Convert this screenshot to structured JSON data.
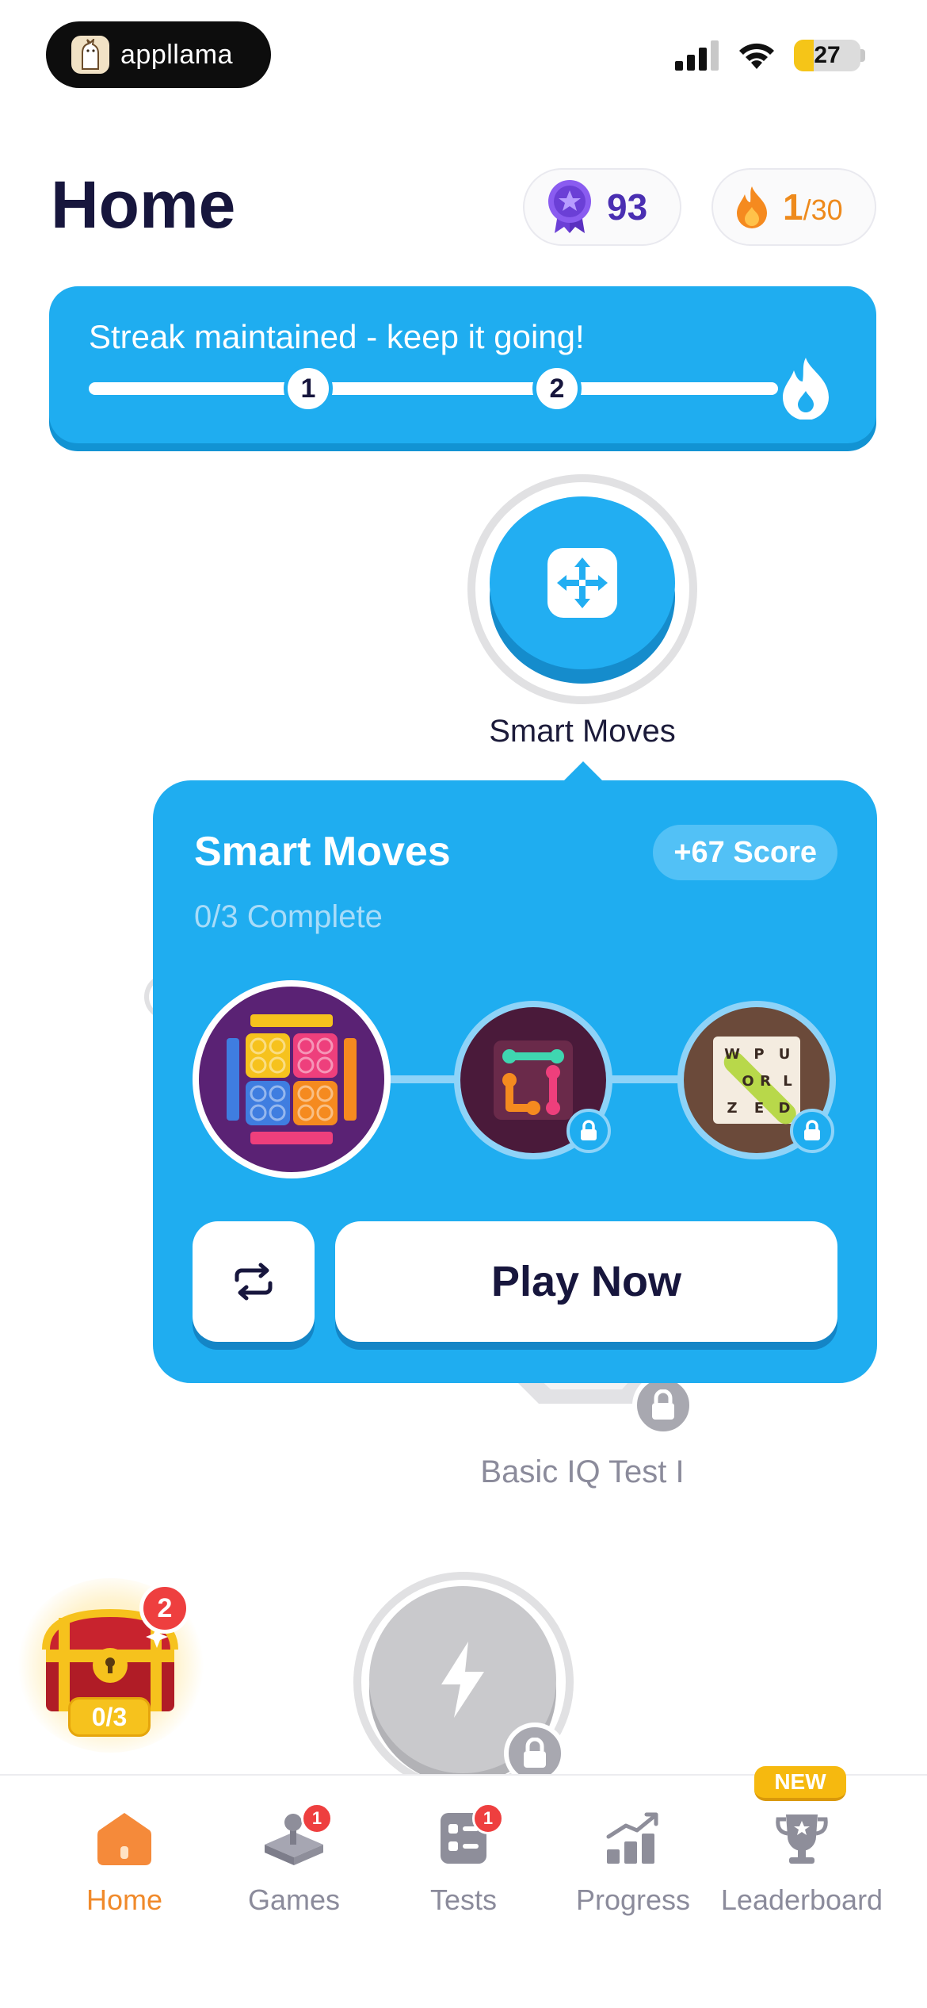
{
  "status_bar": {
    "app_name": "appllama",
    "battery": "27"
  },
  "header": {
    "title": "Home",
    "score": "93",
    "streak_current": "1",
    "streak_total": "/30"
  },
  "streak_banner": {
    "text": "Streak maintained - keep it going!",
    "steps": [
      "1",
      "2"
    ]
  },
  "map": {
    "current_node_label": "Smart Moves",
    "locked_node_label": "Basic IQ Test I"
  },
  "popup": {
    "title": "Smart Moves",
    "progress": "0/3 Complete",
    "score_badge": "+67 Score",
    "play_label": "Play Now",
    "word_search_letters": [
      "W",
      "P",
      "U",
      "O",
      "R",
      "L",
      "Z",
      "E",
      "D"
    ]
  },
  "chest": {
    "count": "0/3",
    "badge": "2"
  },
  "bottom_nav": {
    "items": [
      {
        "label": "Home",
        "badge": ""
      },
      {
        "label": "Games",
        "badge": "1"
      },
      {
        "label": "Tests",
        "badge": "1"
      },
      {
        "label": "Progress",
        "badge": ""
      },
      {
        "label": "Leaderboard",
        "badge": ""
      }
    ],
    "new_label": "NEW"
  },
  "colors": {
    "primary_blue": "#1fadf0",
    "accent_orange": "#f08a2b",
    "score_purple": "#4a2fb2",
    "badge_red": "#ee3f3f"
  }
}
